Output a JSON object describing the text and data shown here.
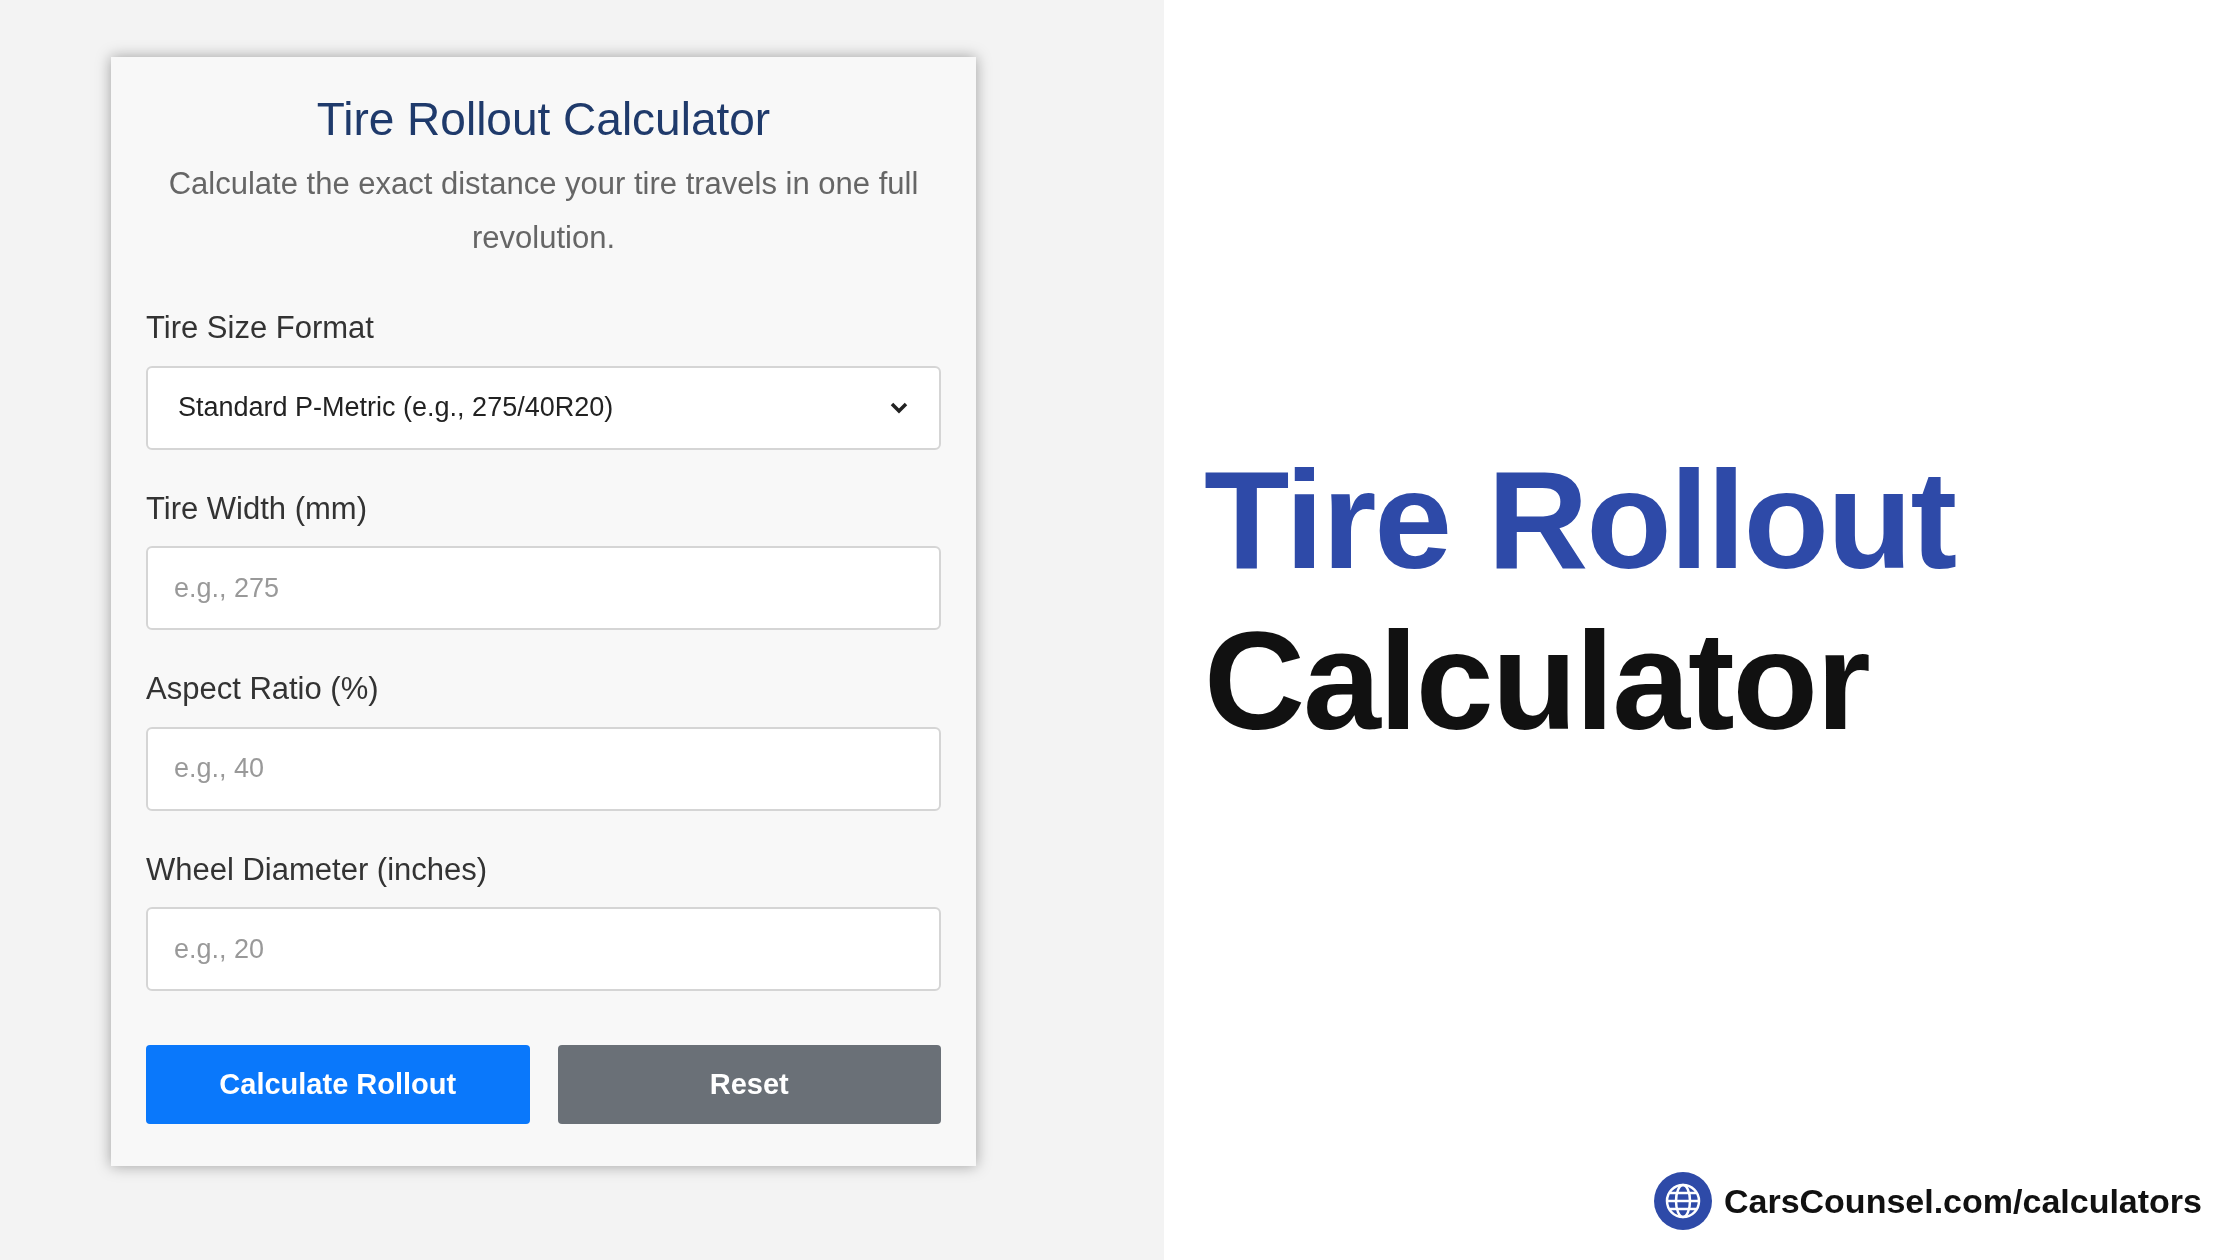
{
  "card": {
    "title": "Tire Rollout Calculator",
    "subtitle": "Calculate the exact distance your tire travels in one full revolution.",
    "fields": [
      {
        "kind": "select",
        "label": "Tire Size Format",
        "value": "Standard P-Metric (e.g., 275/40R20)"
      },
      {
        "kind": "input",
        "label": "Tire Width (mm)",
        "placeholder": "e.g., 275"
      },
      {
        "kind": "input",
        "label": "Aspect Ratio (%)",
        "placeholder": "e.g., 40"
      },
      {
        "kind": "input",
        "label": "Wheel Diameter (inches)",
        "placeholder": "e.g., 20"
      }
    ],
    "buttons": [
      {
        "label": "Calculate Rollout",
        "kind": "primary"
      },
      {
        "label": "Reset",
        "kind": "secondary"
      }
    ]
  },
  "headline": {
    "line_1": "Tire Rollout",
    "line_2": "Calculator"
  },
  "footer": {
    "link": "CarsCounsel.com/calculators"
  }
}
